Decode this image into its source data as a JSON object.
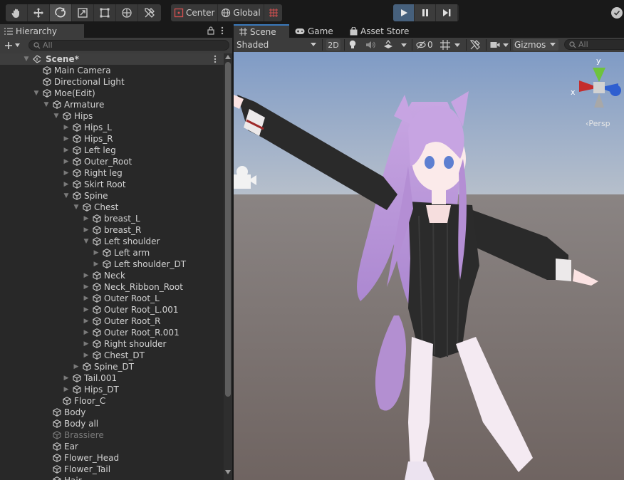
{
  "toolbar": {
    "pivot_label": "Center",
    "space_label": "Global"
  },
  "hierarchy": {
    "tab_label": "Hierarchy",
    "search_placeholder": "All",
    "scene_label": "Scene*",
    "rows": [
      {
        "label": "Main Camera",
        "depth": 0,
        "arrow": "none"
      },
      {
        "label": "Directional Light",
        "depth": 0,
        "arrow": "none"
      },
      {
        "label": "Moe(Edit)",
        "depth": 0,
        "arrow": "down"
      },
      {
        "label": "Armature",
        "depth": 1,
        "arrow": "down"
      },
      {
        "label": "Hips",
        "depth": 2,
        "arrow": "down"
      },
      {
        "label": "Hips_L",
        "depth": 3,
        "arrow": "right"
      },
      {
        "label": "Hips_R",
        "depth": 3,
        "arrow": "right"
      },
      {
        "label": "Left leg",
        "depth": 3,
        "arrow": "right"
      },
      {
        "label": "Outer_Root",
        "depth": 3,
        "arrow": "right"
      },
      {
        "label": "Right leg",
        "depth": 3,
        "arrow": "right"
      },
      {
        "label": "Skirt Root",
        "depth": 3,
        "arrow": "right"
      },
      {
        "label": "Spine",
        "depth": 3,
        "arrow": "down"
      },
      {
        "label": "Chest",
        "depth": 4,
        "arrow": "down"
      },
      {
        "label": "breast_L",
        "depth": 5,
        "arrow": "right"
      },
      {
        "label": "breast_R",
        "depth": 5,
        "arrow": "right"
      },
      {
        "label": "Left shoulder",
        "depth": 5,
        "arrow": "down"
      },
      {
        "label": "Left arm",
        "depth": 6,
        "arrow": "right"
      },
      {
        "label": "Left shoulder_DT",
        "depth": 6,
        "arrow": "right"
      },
      {
        "label": "Neck",
        "depth": 5,
        "arrow": "right"
      },
      {
        "label": "Neck_Ribbon_Root",
        "depth": 5,
        "arrow": "right"
      },
      {
        "label": "Outer Root_L",
        "depth": 5,
        "arrow": "right"
      },
      {
        "label": "Outer Root_L.001",
        "depth": 5,
        "arrow": "right"
      },
      {
        "label": "Outer Root_R",
        "depth": 5,
        "arrow": "right"
      },
      {
        "label": "Outer Root_R.001",
        "depth": 5,
        "arrow": "right"
      },
      {
        "label": "Right shoulder",
        "depth": 5,
        "arrow": "right"
      },
      {
        "label": "Chest_DT",
        "depth": 5,
        "arrow": "right"
      },
      {
        "label": "Spine_DT",
        "depth": 4,
        "arrow": "right"
      },
      {
        "label": "Tail.001",
        "depth": 3,
        "arrow": "right"
      },
      {
        "label": "Hips_DT",
        "depth": 3,
        "arrow": "right"
      },
      {
        "label": "Floor_C",
        "depth": 2,
        "arrow": "none"
      },
      {
        "label": "Body",
        "depth": 1,
        "arrow": "none"
      },
      {
        "label": "Body all",
        "depth": 1,
        "arrow": "none"
      },
      {
        "label": "Brassiere",
        "depth": 1,
        "arrow": "none",
        "inactive": true
      },
      {
        "label": "Ear",
        "depth": 1,
        "arrow": "none"
      },
      {
        "label": "Flower_Head",
        "depth": 1,
        "arrow": "none"
      },
      {
        "label": "Flower_Tail",
        "depth": 1,
        "arrow": "none"
      },
      {
        "label": "Hair",
        "depth": 1,
        "arrow": "none"
      }
    ]
  },
  "scene_view": {
    "tabs": [
      {
        "label": "Scene",
        "active": true
      },
      {
        "label": "Game",
        "active": false
      },
      {
        "label": "Asset Store",
        "active": false
      }
    ],
    "draw_mode": "Shaded",
    "mode_2d": "2D",
    "hidden_count": "0",
    "gizmos_label": "Gizmos",
    "search_placeholder": "All",
    "projection_label": "Persp",
    "axis_x": "x",
    "axis_y": "y"
  },
  "colors": {
    "sky": "#8aa3c9",
    "ground": "#756b69",
    "play_active": "#46607c",
    "tab_accent": "#3a79bb"
  }
}
